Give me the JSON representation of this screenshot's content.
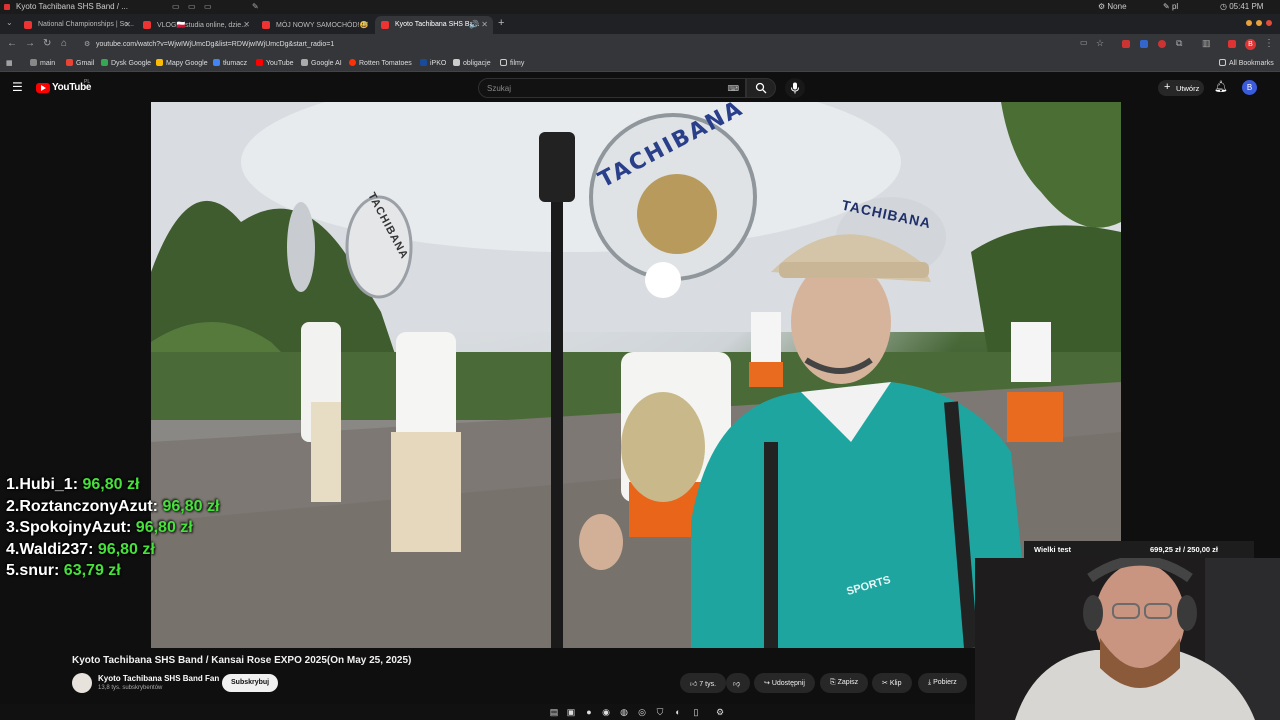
{
  "os": {
    "window_title": "Kyoto Tachibana SHS Band / ...",
    "user": "None",
    "layout": "pl",
    "clock": "05:41 PM"
  },
  "tabs": [
    {
      "label": "National Championships | So...",
      "active": false
    },
    {
      "label": "VLOG🇵🇱studia online, dzie...",
      "active": false
    },
    {
      "label": "MÓJ NOWY SAMOCHÓD!😃",
      "active": false
    },
    {
      "label": "Kyoto Tachibana SHS Ba...",
      "active": true
    }
  ],
  "address": {
    "url": "youtube.com/watch?v=WjwIWjUmcDg&list=RDWjwIWjUmcDg&start_radio=1"
  },
  "bookmarks": [
    {
      "label": "main",
      "color": "#e8e8e8"
    },
    {
      "label": "Gmail",
      "color": "#ea4335"
    },
    {
      "label": "Dysk Google",
      "color": "#34a853"
    },
    {
      "label": "Mapy Google",
      "color": "#fbbc05"
    },
    {
      "label": "tłumacz",
      "color": "#4285f4"
    },
    {
      "label": "YouTube",
      "color": "#ff0000"
    },
    {
      "label": "Google AI",
      "color": "#aaaaaa"
    },
    {
      "label": "Rotten Tomatoes",
      "color": "#fa320a"
    },
    {
      "label": "iPKO",
      "color": "#1a4a9c"
    },
    {
      "label": "obligacje",
      "color": "#cccccc"
    },
    {
      "label": "filmy",
      "color": "#cccccc"
    }
  ],
  "all_bookmarks": "All Bookmarks",
  "youtube": {
    "logo": "YouTube",
    "region": "PL",
    "search_placeholder": "Szukaj",
    "create_label": "Utwórz",
    "avatar_letter": "B"
  },
  "leaderboard": [
    {
      "rank": "1.",
      "name": "Hubi_1:",
      "amount": "96,80 zł"
    },
    {
      "rank": "2.",
      "name": "RoztanczonyAzut:",
      "amount": "96,80 zł"
    },
    {
      "rank": "3.",
      "name": "SpokojnyAzut:",
      "amount": "96,80 zł"
    },
    {
      "rank": "4.",
      "name": "Waldi237:",
      "amount": "96,80 zł"
    },
    {
      "rank": "5.",
      "name": "snur:",
      "amount": "63,79 zł"
    }
  ],
  "video": {
    "title": "Kyoto Tachibana SHS Band / Kansai Rose EXPO 2025(On May 25, 2025)",
    "channel": "Kyoto Tachibana SHS Band Fan",
    "subscribers": "13,8 tys. subskrybentów",
    "subscribe_label": "Subskrybuj",
    "likes": "7 tys.",
    "share_label": "Udostępnij",
    "save_label": "Zapisz",
    "clip_label": "Klip",
    "download_label": "Pobierz",
    "sign_text": "TACHIBANA",
    "jacket_text": "SPORTS"
  },
  "goal": {
    "label": "Wielki test",
    "amount": "699,25 zł",
    "target": "250,00 zł"
  },
  "colors": {
    "accent_green": "#46e23a",
    "youtube_red": "#ff0000"
  }
}
